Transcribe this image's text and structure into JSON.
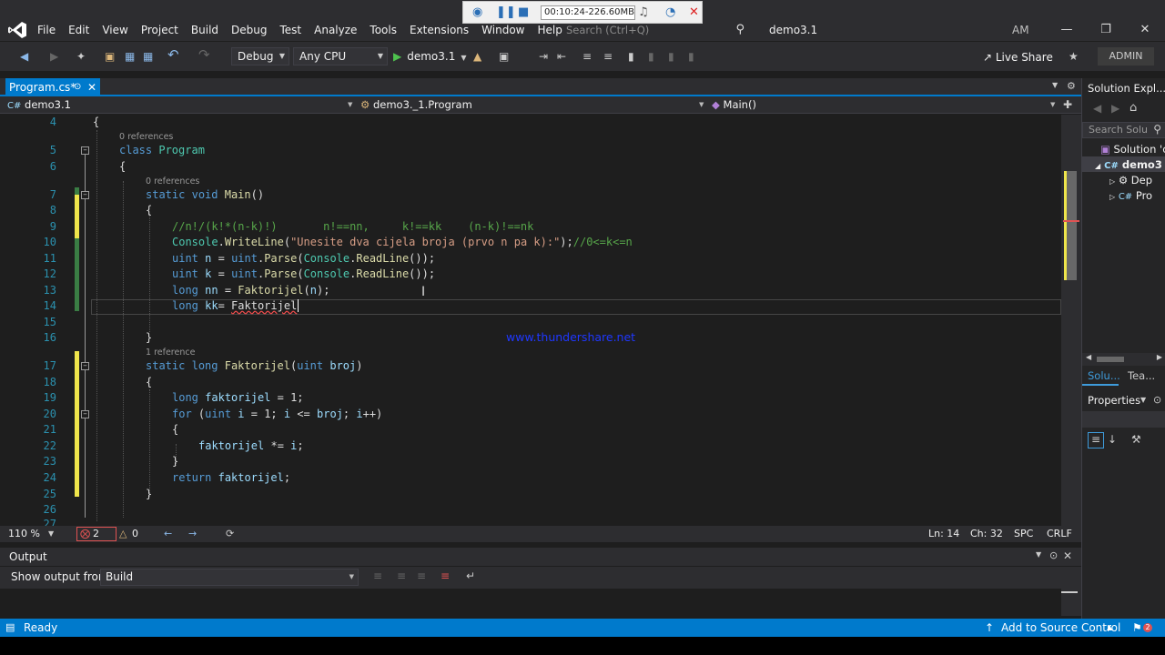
{
  "menu": [
    "File",
    "Edit",
    "View",
    "Project",
    "Build",
    "Debug",
    "Test",
    "Analyze",
    "Tools",
    "Extensions",
    "Window",
    "Help"
  ],
  "search": {
    "placeholder": "Search (Ctrl+Q)"
  },
  "solution_name": "demo3.1",
  "avatar": "AM",
  "recorder": {
    "time": "00:10:24-226.60MB"
  },
  "toolbar": {
    "config": "Debug",
    "platform": "Any CPU",
    "run": "demo3.1",
    "live_share": "Live Share",
    "admin": "ADMIN"
  },
  "tab": {
    "label": "Program.cs*"
  },
  "nav": {
    "project": "demo3.1",
    "class": "demo3._1.Program",
    "member": "Main()"
  },
  "editor": {
    "lines": [
      "4",
      "5",
      "6",
      "7",
      "8",
      "9",
      "10",
      "11",
      "12",
      "13",
      "14",
      "15",
      "16",
      "17",
      "18",
      "19",
      "20",
      "21",
      "22",
      "23",
      "24",
      "25",
      "26",
      "27"
    ],
    "refs": {
      "r0": "0 references",
      "r1": "0 references",
      "r2": "1 reference"
    },
    "code": {
      "l4": "{",
      "l5_kw": "class",
      "l5_ty": "Program",
      "l6": "{",
      "l7_kw1": "static",
      "l7_kw2": "void",
      "l7_fn": "Main",
      "l7_rest": "()",
      "l8": "{",
      "l9_cm": "//n!/(k!*(n-k)!)       n!==nn,     k!==kk    (n-k)!==nk",
      "l10_ty": "Console",
      "l10_dot": ".",
      "l10_fn": "WriteLine",
      "l10_p1": "(",
      "l10_str": "\"Unesite dva cijela broja (prvo n pa k):\"",
      "l10_p2": ");",
      "l10_cm": "//0<=k<=n",
      "l11_kw": "uint",
      "l11_var": "n",
      "l11_eq": " = ",
      "l11_kw2": "uint",
      "l11_dot": ".",
      "l11_fn": "Parse",
      "l11_p": "(",
      "l11_ty": "Console",
      "l11_dot2": ".",
      "l11_fn2": "ReadLine",
      "l11_end": "());",
      "l12_kw": "uint",
      "l12_var": "k",
      "l12_eq": " = ",
      "l12_kw2": "uint",
      "l12_dot": ".",
      "l12_fn": "Parse",
      "l12_p": "(",
      "l12_ty": "Console",
      "l12_dot2": ".",
      "l12_fn2": "ReadLine",
      "l12_end": "());",
      "l13_kw": "long",
      "l13_var": "nn",
      "l13_eq": " = ",
      "l13_fn": "Faktorijel",
      "l13_p": "(",
      "l13_arg": "n",
      "l13_end": ");",
      "l14_kw": "long",
      "l14_var": "kk",
      "l14_eq": "= ",
      "l14_id": "Faktorijel",
      "l16": "}",
      "l17_kw1": "static",
      "l17_kw2": "long",
      "l17_fn": "Faktorijel",
      "l17_p": "(",
      "l17_kw3": "uint",
      "l17_arg": "broj",
      "l17_end": ")",
      "l18": "{",
      "l19_kw": "long",
      "l19_var": "faktorijel",
      "l19_rest": " = 1;",
      "l20_kw": "for",
      "l20_p": " (",
      "l20_kw2": "uint",
      "l20_i": "i",
      "l20_a": " = 1; ",
      "l20_i2": "i",
      "l20_b": " <= ",
      "l20_broj": "broj",
      "l20_c": "; ",
      "l20_i3": "i",
      "l20_d": "++)",
      "l21": "{",
      "l22_var": "faktorijel",
      "l22_a": " *= ",
      "l22_i": "i",
      "l22_b": ";",
      "l23": "}",
      "l24_kw": "return",
      "l24_var": "faktorijel",
      "l24_b": ";",
      "l25": "}"
    },
    "watermark": "www.thundershare.net"
  },
  "bottom": {
    "zoom": "110 %",
    "errors": "2",
    "warnings": "0",
    "ln": "Ln: 14",
    "ch": "Ch: 32",
    "spc": "SPC",
    "crlf": "CRLF"
  },
  "output": {
    "title": "Output",
    "show_from": "Show output from:",
    "source": "Build"
  },
  "status": {
    "ready": "Ready",
    "source_control": "Add to Source Control",
    "notif": "2"
  },
  "solution_explorer": {
    "title": "Solution Expl...",
    "search": "Search Solu",
    "root": "Solution 'c",
    "project": "demo3",
    "deps": "Dep",
    "prog": "Pro",
    "tab1": "Solu...",
    "tab2": "Tea..."
  },
  "properties": {
    "title": "Properties"
  },
  "colors": {
    "accent": "#007acc",
    "bg": "#1e1e1e",
    "chrome": "#2d2d30",
    "keyword": "#569cd6",
    "type": "#4ec9b0",
    "string": "#d69d85",
    "comment": "#57a64a",
    "line_number": "#2b91af"
  }
}
